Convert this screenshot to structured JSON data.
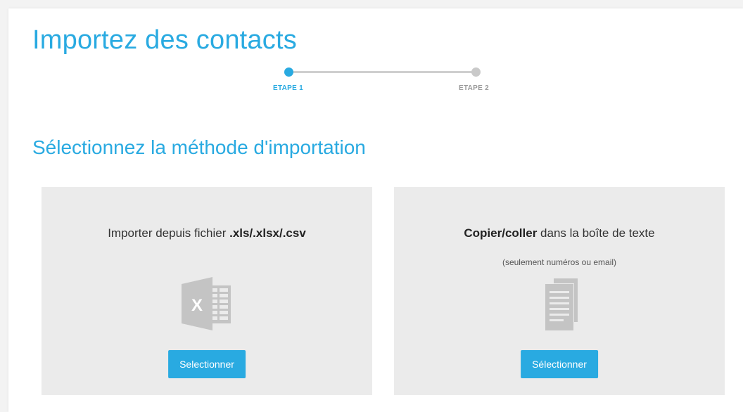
{
  "page": {
    "title": "Importez des contacts",
    "section_title": "Sélectionnez la méthode d'importation"
  },
  "stepper": {
    "steps": [
      {
        "label": "ETAPE 1",
        "state": "active"
      },
      {
        "label": "ETAPE 2",
        "state": "inactive"
      }
    ]
  },
  "cards": {
    "file": {
      "title_prefix": "Importer depuis fichier ",
      "title_bold": ".xls/.xlsx/.csv",
      "icon": "excel-file-icon",
      "button_label": "Selectionner"
    },
    "paste": {
      "title_bold": "Copier/coller",
      "title_suffix": " dans la boîte de texte",
      "subtitle": "(seulement numéros ou email)",
      "icon": "text-documents-icon",
      "button_label": "Sélectionner"
    }
  },
  "colors": {
    "accent": "#29aae1",
    "card_background": "#ebebeb",
    "icon_gray": "#c4c4c4",
    "step_inactive": "#c9c9c9"
  }
}
